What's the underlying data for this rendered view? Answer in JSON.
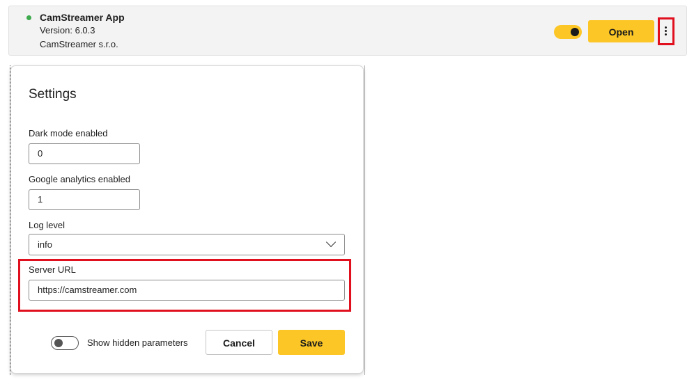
{
  "app": {
    "status_color": "#3daa4d",
    "name": "CamStreamer App",
    "version": "Version: 6.0.3",
    "vendor": "CamStreamer s.r.o.",
    "enabled": true,
    "open_label": "Open",
    "more_icon": "more-vertical-icon"
  },
  "dialog": {
    "title": "Settings",
    "fields": {
      "dark_mode": {
        "label": "Dark mode enabled",
        "value": "0"
      },
      "google_analytics": {
        "label": "Google analytics enabled",
        "value": "1"
      },
      "log_level": {
        "label": "Log level",
        "value": "info"
      },
      "server_url": {
        "label": "Server URL",
        "value": "https://camstreamer.com"
      }
    },
    "show_hidden": {
      "label": "Show hidden parameters",
      "enabled": false
    },
    "cancel_label": "Cancel",
    "save_label": "Save"
  },
  "colors": {
    "accent": "#fcc626",
    "highlight": "#e0101e"
  }
}
